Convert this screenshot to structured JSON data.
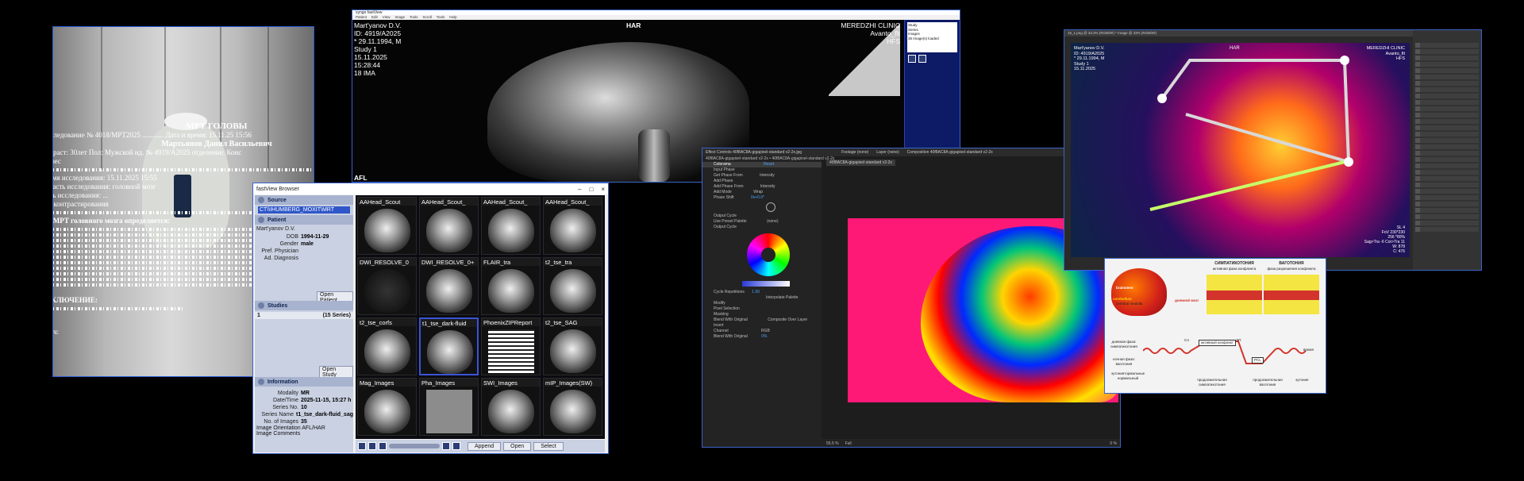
{
  "report": {
    "title": "МРТ ГОЛОВЫ",
    "line1": "Исследование  № 4018/МРТ2025 ............ Дата и время: 15.11.25 15:56",
    "patient": "Мартьянов Данил Васильевич",
    "line3": "Возраст:      30лет        Пол:        Мужской      ид. №       4919/A2025 отделение:  Конс",
    "line4": "Адрес",
    "time": "время исследования: 15.11.2025 15:55",
    "area": "область исследования: головной мозг",
    "goal": "цель исследования: ...",
    "contrast": "без контрастирования",
    "heading": "На МРТ головного мозга определяется:",
    "conclusion": "ЗАКЛЮЧЕНИЕ:",
    "doctor": "Врач:"
  },
  "browser": {
    "title": "fastView Browser",
    "source_label": "Source",
    "source_value": "CT\\\\IHUMBERG_MOXIT\\MRT",
    "patient_label": "Patient",
    "patient_name": "Mart'yanov D.V.",
    "fields": [
      {
        "k": "DOB",
        "v": "1994-11-29"
      },
      {
        "k": "Gender",
        "v": "male"
      },
      {
        "k": "Pref. Physician",
        "v": ""
      },
      {
        "k": "Ad. Diagnosis",
        "v": ""
      }
    ],
    "open_patient": "Open Patient",
    "studies_label": "Studies",
    "study_row_left": "1",
    "study_row_right": "(15 Series)",
    "open_study": "Open Study",
    "info_label": "Information",
    "info": [
      {
        "k": "Modality",
        "v": "MR"
      },
      {
        "k": "Date/Time",
        "v": "2025-11-15, 15:27 h"
      },
      {
        "k": "Series No.",
        "v": "10"
      },
      {
        "k": "Series Name",
        "v": "t1_tse_dark-fluid_sag"
      },
      {
        "k": "No. of Images",
        "v": "35"
      }
    ],
    "orientation": "Image Orientation AFL/HAR",
    "comments": "Image Comments",
    "thumbs": [
      "AAHead_Scout",
      "AAHead_Scout_",
      "AAHead_Scout_",
      "AAHead_Scout_",
      "DWI_RESOLVE_0",
      "DWI_RESOLVE_0+",
      "FLAIR_tra",
      "t2_tse_tra",
      "t2_tse_corfs",
      "t1_tse_dark-fluid",
      "PhoenixZIPReport",
      "t2_tse_SAG",
      "Mag_Images",
      "Pha_Images",
      "SWI_Images",
      "mIP_Images(SW)"
    ],
    "append": "Append",
    "open": "Open",
    "select": "Select"
  },
  "viewer": {
    "title": "syngo fastView",
    "menu": [
      "Patient",
      "Edit",
      "View",
      "Image",
      "Tools",
      "Scroll",
      "Tools",
      "Help"
    ],
    "top_center": "HAR",
    "patient_info": [
      "Mart'yanov D.V.",
      "ID: 4919/A2025",
      "* 29.11.1994, M",
      "Study 1",
      "15.11.2025",
      "15:28:44",
      "18 IMA"
    ],
    "clinic": [
      "MEREDZHI CLINIC",
      "Avanto_fit",
      "HFS"
    ],
    "bottom_left": "AFL",
    "side_info": [
      "Study",
      "Series",
      "Images",
      "35 Image(s) loaded"
    ],
    "side_vals": [
      "1 of 1",
      "1 of 1"
    ]
  },
  "ae": {
    "title": "Effect Controls 40f8AC8A-gigapixel-standard v2-2x.jpg",
    "panel_tabs": [
      "Footage (none)",
      "Layer (none)",
      "Composition 40f8AC8A-gigapixel-standard v2-2x"
    ],
    "comp_tab": "40f8AC8A-gigapixel-standard v2-2x",
    "subtitle": "40f8AC8A-gigapixel-standard v2-2x • 40f8AC8A-gigapixel-standard v2-2x",
    "rows": [
      "Colorama",
      "Input Phase",
      "Get Phase From",
      "Add Phase",
      "Add Phase From",
      "Add Mode",
      "Phase Shift",
      "Output Cycle",
      "Use Preset Palette",
      "Output Cycle",
      "Cycle Repetitions",
      "Modify",
      "Pixel Selection",
      "Masking",
      "Blend With Original",
      "Invert",
      "Channel",
      "Blend With Original"
    ],
    "reset": "Reset",
    "intensity": "Intensity",
    "wrap": "Wrap",
    "phase": "0x+0.0°",
    "none": "(none)",
    "interp": "Interpolate Palette",
    "composite": "Composite Over Layer",
    "rgb": "RGB",
    "zoom": "55.5 %",
    "full": "Full",
    "cycle": "1.00",
    "pct": "0%",
    "blend2": "0 %"
  },
  "ps": {
    "tab": "15_1.png @ 33.3% (RGB/8#) * Image @ 33% (RGB/8#)",
    "har": "HAR",
    "left_info": [
      "Mart'yanov D.V.",
      "ID: 4919/A2025",
      "* 29.11.1994, M",
      "Study 1",
      "15.11.2025"
    ],
    "clinic": [
      "MEREDZHI CLINIC",
      "Avanto_fit",
      "HFS"
    ],
    "bottom_right": [
      "SL 4",
      "FoV 230*230",
      "256 *80%",
      "Sag>Tra -6 Cor>Tra 11",
      "W: 878",
      "C: 476"
    ]
  },
  "diag": {
    "col1": "СИМПАТИКОТОНИЯ",
    "col1b": "активная фаза конфликта",
    "col2": "ВАГОТОНИЯ",
    "col2b": "фаза разрешения конфликта",
    "left": [
      "brainstem",
      "cerebellum",
      "cerebral medulla",
      "cortex",
      "мозг",
      "дневной мозг"
    ],
    "rows": [
      "дневная фаза: симпатикотония",
      "ночная фаза: ваготония",
      "эутониятормальные нормальный"
    ],
    "bottom": [
      "продолжительная симпатикотония",
      "продолжительная ваготония",
      "эутония"
    ],
    "tags": [
      "CA",
      "ЭП",
      "активный конфликт",
      "PCL",
      "без ваготонии",
      "время"
    ]
  }
}
